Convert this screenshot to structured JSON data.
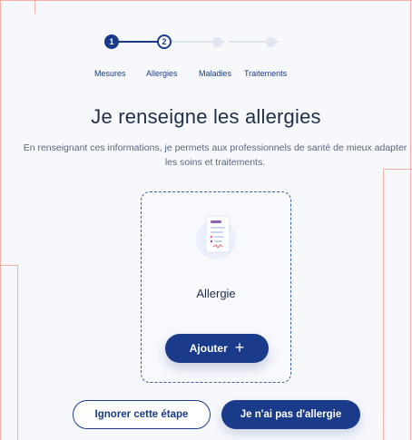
{
  "stepper": {
    "steps": [
      {
        "number": "1",
        "label": "Mesures",
        "state": "completed"
      },
      {
        "number": "2",
        "label": "Allergies",
        "state": "current"
      },
      {
        "number": "",
        "label": "Maladies",
        "state": "upcoming"
      },
      {
        "number": "",
        "label": "Traitements",
        "state": "upcoming"
      }
    ]
  },
  "page": {
    "title": "Je renseigne les allergies",
    "description": "En renseignant ces informations, je permets aux professionnels de santé de mieux adapter les soins et traitements."
  },
  "card": {
    "title": "Allergie",
    "add_label": "Ajouter",
    "add_icon": "plus-icon"
  },
  "actions": {
    "skip_label": "Ignorer cette étape",
    "no_allergy_label": "Je n'ai pas d'allergie"
  },
  "colors": {
    "primary": "#1a3a8a",
    "background": "#f6f8fc",
    "guide": "#f2b1a3",
    "inactive": "#dfe5f1"
  }
}
